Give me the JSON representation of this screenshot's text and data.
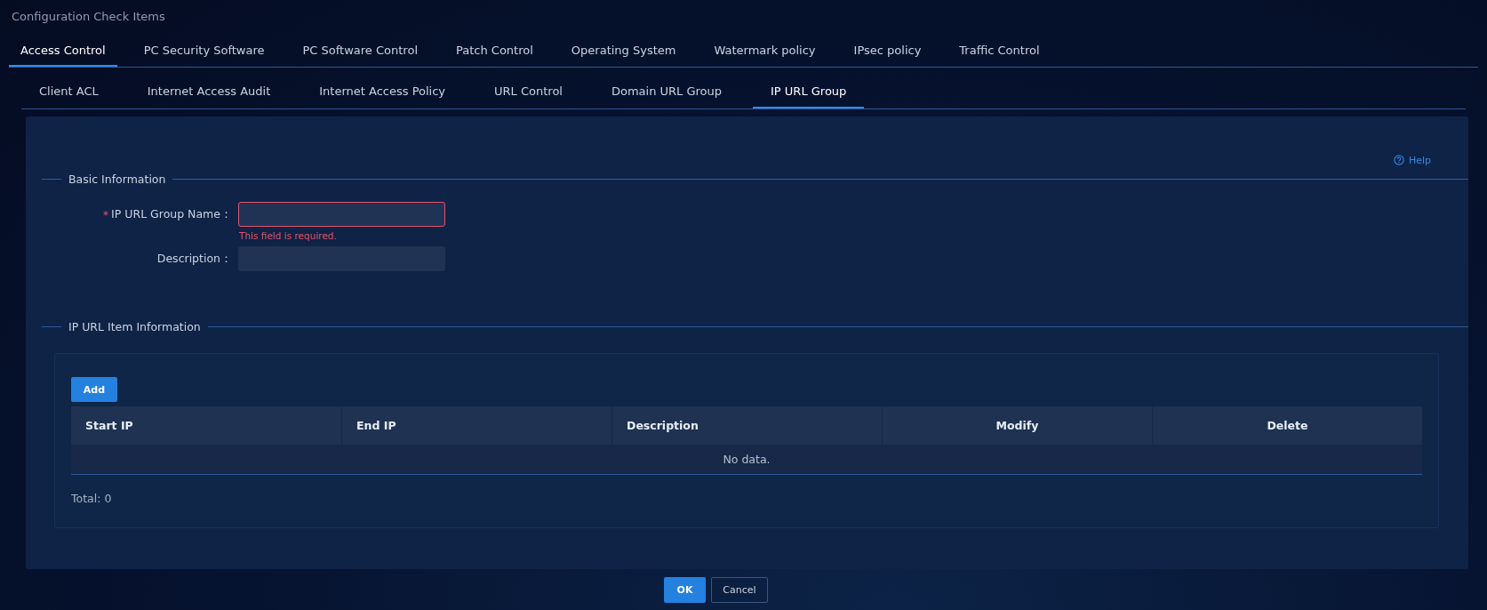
{
  "window": {
    "title": "Configuration Check Items"
  },
  "tabs": [
    {
      "label": "Access Control",
      "selected": true
    },
    {
      "label": "PC Security Software",
      "selected": false
    },
    {
      "label": "PC Software Control",
      "selected": false
    },
    {
      "label": "Patch Control",
      "selected": false
    },
    {
      "label": "Operating System",
      "selected": false
    },
    {
      "label": "Watermark policy",
      "selected": false
    },
    {
      "label": "IPsec policy",
      "selected": false
    },
    {
      "label": "Traffic Control",
      "selected": false
    }
  ],
  "subtabs": [
    {
      "label": "Client ACL",
      "selected": false
    },
    {
      "label": "Internet Access Audit",
      "selected": false
    },
    {
      "label": "Internet Access Policy",
      "selected": false
    },
    {
      "label": "URL Control",
      "selected": false
    },
    {
      "label": "Domain URL Group",
      "selected": false
    },
    {
      "label": "IP URL Group",
      "selected": true
    }
  ],
  "help": "Help",
  "basic_section": {
    "legend": "Basic Information",
    "fields": [
      {
        "label": "IP URL Group Name：",
        "required_mark": "*",
        "error": "This field is required."
      },
      {
        "label": "Description："
      }
    ]
  },
  "items_section": {
    "legend": "IP URL Item Information",
    "add_button": "Add",
    "table": {
      "columns": [
        "Start IP",
        "End IP",
        "Description",
        "Modify",
        "Delete"
      ],
      "empty_text": "No data."
    },
    "total": "Total: 0"
  },
  "buttons": [
    {
      "label": "OK",
      "kind": "primary"
    },
    {
      "label": "Cancel",
      "kind": "secondary"
    }
  ]
}
